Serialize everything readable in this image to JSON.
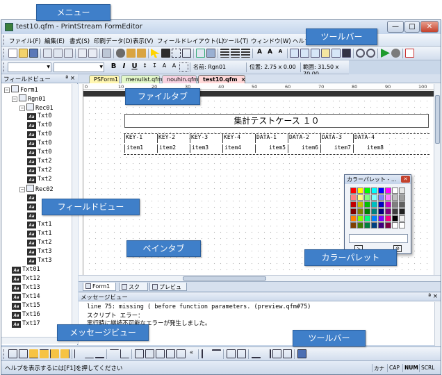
{
  "callouts": {
    "menu": "メニュー",
    "toolbar_top": "ツールバー",
    "file_tab": "ファイルタブ",
    "field_view": "フィールドビュー",
    "pane_tab": "ペインタブ",
    "color_palette": "カラーパレット",
    "message_view": "メッセージビュー",
    "toolbar_bottom": "ツールバー"
  },
  "window": {
    "title": "test10.qfm - PrintStream FormEditor",
    "min": "—",
    "max": "□",
    "close": "✕"
  },
  "menu": [
    "ファイル(F)",
    "編集(E)",
    "書式(S)",
    "印刷データ(D)",
    "表示(V)",
    "フィールドレイアウト(L)",
    "ツール(T)",
    "ウィンドウ(W)",
    "ヘルプ(H)"
  ],
  "format_bar": {
    "bold": "B",
    "italic": "I",
    "underline": "U",
    "name_label": "名前: Rgn01",
    "position_label": "位置: 2.75 x 0.00",
    "range_label": "範囲: 31.50 x 70.00"
  },
  "field_view": {
    "title": "フィールドビュー",
    "pin": "ª ×",
    "tree": [
      {
        "label": "Form1",
        "level": 0,
        "type": "node",
        "pm": "−"
      },
      {
        "label": "Rgn01",
        "level": 1,
        "type": "node",
        "pm": "−"
      },
      {
        "label": "Rec01",
        "level": 2,
        "type": "node",
        "pm": "−"
      },
      {
        "label": "Txt0",
        "level": 3,
        "type": "field"
      },
      {
        "label": "Txt0",
        "level": 3,
        "type": "field"
      },
      {
        "label": "Txt0",
        "level": 3,
        "type": "field"
      },
      {
        "label": "Txt0",
        "level": 3,
        "type": "field"
      },
      {
        "label": "Txt0",
        "level": 3,
        "type": "field"
      },
      {
        "label": "Txt2",
        "level": 3,
        "type": "field"
      },
      {
        "label": "Txt2",
        "level": 3,
        "type": "field"
      },
      {
        "label": "Txt2",
        "level": 3,
        "type": "field"
      },
      {
        "label": "Rec02",
        "level": 2,
        "type": "node",
        "pm": "−"
      },
      {
        "label": "",
        "level": 3,
        "type": "field"
      },
      {
        "label": "",
        "level": 3,
        "type": "field"
      },
      {
        "label": "",
        "level": 3,
        "type": "field"
      },
      {
        "label": "Txt1",
        "level": 3,
        "type": "field"
      },
      {
        "label": "Txt1",
        "level": 3,
        "type": "field"
      },
      {
        "label": "Txt2",
        "level": 3,
        "type": "field"
      },
      {
        "label": "Txt3",
        "level": 3,
        "type": "field"
      },
      {
        "label": "Txt3",
        "level": 3,
        "type": "field"
      },
      {
        "label": "Txt01",
        "level": 1,
        "type": "field"
      },
      {
        "label": "Txt12",
        "level": 1,
        "type": "field"
      },
      {
        "label": "Txt13",
        "level": 1,
        "type": "field"
      },
      {
        "label": "Txt14",
        "level": 1,
        "type": "field"
      },
      {
        "label": "Txt15",
        "level": 1,
        "type": "field"
      },
      {
        "label": "Txt16",
        "level": 1,
        "type": "field"
      },
      {
        "label": "Txt17",
        "level": 1,
        "type": "field"
      }
    ]
  },
  "file_tabs": [
    {
      "label": "PSForm1",
      "color": "#fff6b0"
    },
    {
      "label": "menulist.qfm",
      "color": "#e3f7c9"
    },
    {
      "label": "nouhin.qfm",
      "color": "#f7d2e0"
    },
    {
      "label": "test10.qfm",
      "color": "#ffd7d7",
      "active": true,
      "close": "×"
    }
  ],
  "ruler": [
    "0",
    "10",
    "20",
    "30",
    "40",
    "50",
    "60",
    "70",
    "80",
    "90",
    "100",
    "110"
  ],
  "form": {
    "title": "集計テストケース １０",
    "headers": [
      "KEY-1",
      "KEY-2",
      "KEY-3",
      "KEY-4",
      "DATA-1",
      "DATA-2",
      "DATA-3",
      "DATA-4"
    ],
    "items": [
      "item1",
      "item2",
      "item3",
      "item4",
      "item5",
      "item6",
      "item7",
      "item8"
    ]
  },
  "pane_tabs": [
    "Form1",
    "スクリプト",
    "プレビュー"
  ],
  "message_view": {
    "title": "メッセージビュー",
    "pin": "ª ×",
    "lines": [
      "line 75: missing ( before function parameters. (preview.qfm#75)",
      "スクリプト エラー：",
      "実行時に継続不可能なエラーが発生しました。"
    ]
  },
  "palette": {
    "title": "カラーパレット - ...",
    "close": "✕",
    "rows": [
      [
        "#ff0000",
        "#ffff00",
        "#00ff00",
        "#00ffff",
        "#0000ff",
        "#ff00ff",
        "#ffffff",
        "#e6e6e6"
      ],
      [
        "#ff8080",
        "#ffff80",
        "#80ff80",
        "#80ffff",
        "#8080ff",
        "#ff80ff",
        "#c0c0c0",
        "#a0a0a0"
      ],
      [
        "#c00000",
        "#c0c000",
        "#00c000",
        "#00c0c0",
        "#0000c0",
        "#c000c0",
        "#808080",
        "#606060"
      ],
      [
        "#800000",
        "#808000",
        "#008000",
        "#008080",
        "#000080",
        "#800080",
        "#404040",
        "#202020"
      ],
      [
        "#ff8000",
        "#80ff00",
        "#00ff80",
        "#0080ff",
        "#8000ff",
        "#ff0080",
        "#000000",
        "#f0f0f0"
      ],
      [
        "#804000",
        "#408000",
        "#008040",
        "#004080",
        "#400080",
        "#800040",
        "#ffffff",
        "#ffffff"
      ]
    ]
  },
  "status": {
    "help": "ヘルプを表示するには[F1]を押してください",
    "cells": [
      "カナ",
      "CAP",
      "NUM",
      "SCRL"
    ]
  }
}
